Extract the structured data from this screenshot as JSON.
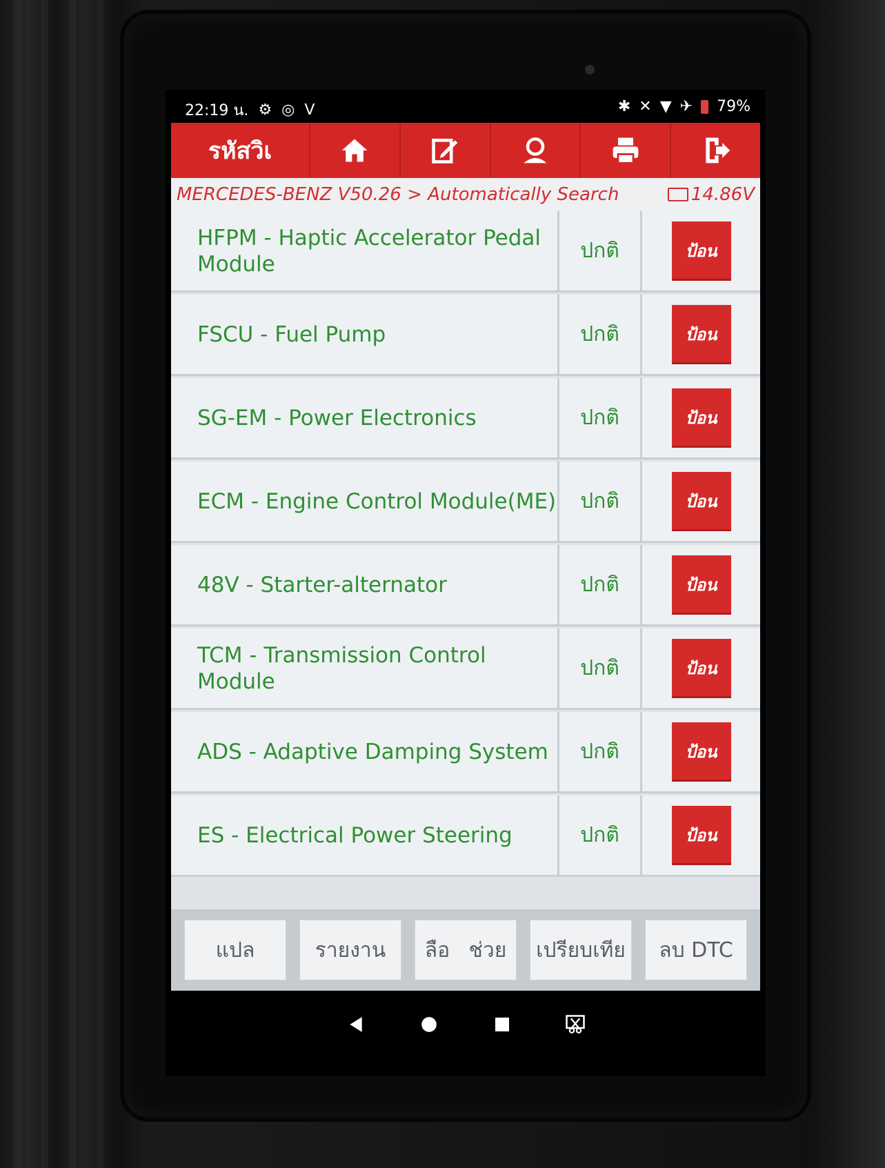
{
  "status_bar": {
    "time": "22:19 น.",
    "battery_percent": "79%"
  },
  "top_nav": {
    "title": "รหัสวิเ",
    "icons": [
      "home-icon",
      "edit-icon",
      "user-icon",
      "printer-icon",
      "exit-icon"
    ]
  },
  "breadcrumb": {
    "path": "MERCEDES-BENZ V50.26 > Automatically Search",
    "voltage": "14.86V"
  },
  "modules": [
    {
      "name": "HFPM - Haptic Accelerator Pedal Module",
      "status": "ปกติ",
      "action": "ป้อน"
    },
    {
      "name": "FSCU - Fuel Pump",
      "status": "ปกติ",
      "action": "ป้อน"
    },
    {
      "name": "SG-EM - Power Electronics",
      "status": "ปกติ",
      "action": "ป้อน"
    },
    {
      "name": "ECM - Engine Control Module(ME)",
      "status": "ปกติ",
      "action": "ป้อน"
    },
    {
      "name": "48V - Starter-alternator",
      "status": "ปกติ",
      "action": "ป้อน"
    },
    {
      "name": "TCM - Transmission Control Module",
      "status": "ปกติ",
      "action": "ป้อน"
    },
    {
      "name": "ADS - Adaptive Damping System",
      "status": "ปกติ",
      "action": "ป้อน"
    },
    {
      "name": "ES - Electrical Power Steering",
      "status": "ปกติ",
      "action": "ป้อน"
    }
  ],
  "bottom_bar": {
    "translate": "แปล",
    "report": "รายงาน",
    "more_a": "ลือ",
    "more_b": "ช่วย",
    "compare": "เปรียบเทีย",
    "clear_dtc": "ลบ DTC"
  },
  "colors": {
    "accent_red": "#d52626",
    "status_green": "#2f8f33",
    "breadcrumb_red": "#d42d2d"
  }
}
